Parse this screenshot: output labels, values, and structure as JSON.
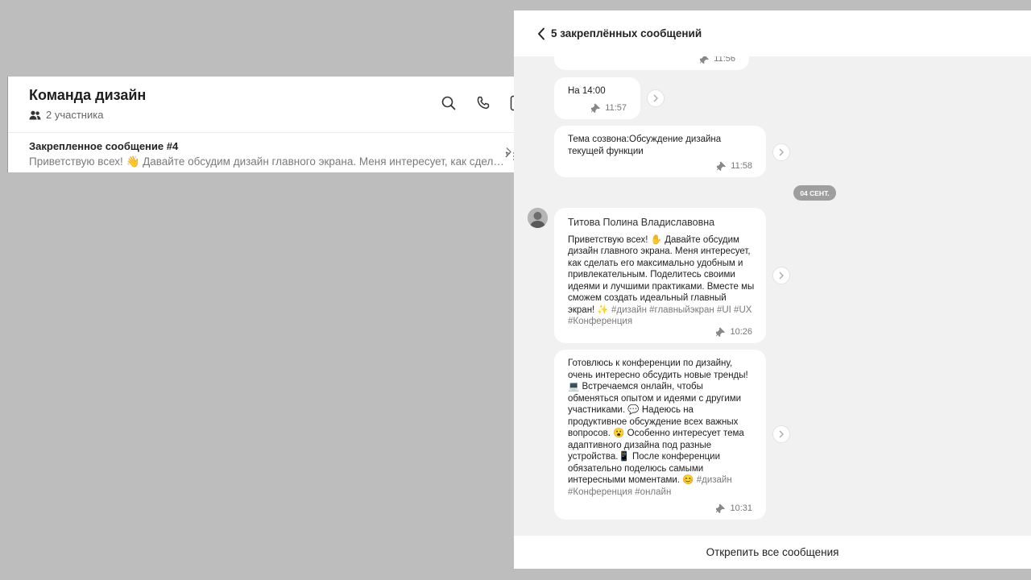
{
  "chat": {
    "title": "Команда дизайн",
    "members": "2 участника",
    "pinned_title": "Закрепленное сообщение #4",
    "pinned_text": "Приветствую всех! 👋 Давайте обсудим дизайн главного экрана. Меня интересует, как сделать его максимально удобным и привлекательным."
  },
  "panel": {
    "title": "5 закреплённых сообщений",
    "date_separator": "04 СЕНТ.",
    "unpin_all": "Открепить все сообщения",
    "messages": [
      {
        "time": "11:56"
      },
      {
        "text": "На 14:00",
        "time": "11:57"
      },
      {
        "text": "Тема созвона:Обсуждение дизайна текущей функции",
        "time": "11:58"
      },
      {
        "author": "Титова Полина Владиславовна",
        "text": "Приветствую всех! ✋ Давайте обсудим дизайн главного экрана.  Меня интересует, как сделать его максимально удобным и привлекательным. Поделитесь своими идеями и лучшими практиками.  Вместе мы сможем создать идеальный главный экран! ✨",
        "hashtags": "#дизайн #главныйэкран #UI #UX #Конференция",
        "time": "10:26"
      },
      {
        "text": "Готовлюсь к конференции по дизайну, очень интересно обсудить новые тренды! 💻  Встречаемся онлайн, чтобы обменяться опытом и идеями с другими участниками.  💬  Надеюсь на продуктивное обсуждение всех важных вопросов.  😮  Особенно интересует тема адаптивного дизайна под разные устройства.📱  После конференции обязательно поделюсь самыми интересными моментами. 😊",
        "hashtags": "#дизайн #Конференция #онлайн",
        "time": "10:31"
      }
    ]
  },
  "icons": {
    "search": "search-icon",
    "phone": "phone-icon",
    "sidebar": "sidebar-toggle-icon",
    "pin": "pin-icon",
    "back": "chevron-left-icon",
    "forward": "chevron-right-icon",
    "members": "people-icon",
    "pinned_list": "pinned-list-icon"
  }
}
